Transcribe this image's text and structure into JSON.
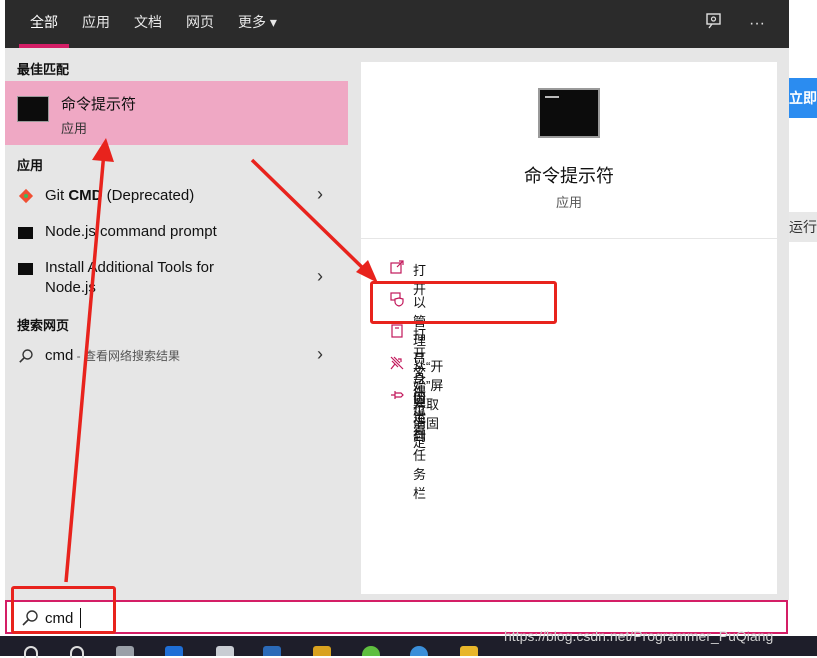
{
  "tabs": [
    {
      "label": "全部",
      "active": true
    },
    {
      "label": "应用"
    },
    {
      "label": "文档"
    },
    {
      "label": "网页"
    },
    {
      "label": "更多"
    }
  ],
  "more_arrow": "▾",
  "top_icons": [
    "feedback-icon",
    "more-options-icon"
  ],
  "more_glyph": "···",
  "best_match": {
    "heading": "最佳匹配",
    "title": "命令提示符",
    "subtitle": "应用"
  },
  "apps": {
    "heading": "应用",
    "items": [
      {
        "label": "Git CMD (Deprecated)",
        "bold": "CMD",
        "prefix": "Git ",
        "suffix": " (Deprecated)"
      },
      {
        "label": "Node.js command prompt"
      },
      {
        "label_line1": "Install Additional Tools for",
        "label_line2": "Node.js"
      }
    ]
  },
  "web": {
    "heading": "搜索网页",
    "query": "cmd",
    "hint": " - 查看网络搜索结果"
  },
  "detail": {
    "title": "命令提示符",
    "subtitle": "应用",
    "actions": [
      {
        "label": "打开",
        "icon": "open-icon"
      },
      {
        "label": "以管理员身份运行",
        "icon": "shield-icon"
      },
      {
        "label": "打开文件位置",
        "icon": "file-location-icon"
      },
      {
        "label": "从“开始”屏幕取消固定",
        "icon": "unpin-icon"
      },
      {
        "label": "固定到任务栏",
        "icon": "pin-icon"
      }
    ]
  },
  "search": {
    "value": "cmd"
  },
  "background": {
    "blue_tab_text": "立即下",
    "gray_tab_text": "运行"
  },
  "watermark": "https://blog.csdn.net/Programmer_PuQiang",
  "colors": {
    "accent": "#d41e66",
    "selection": "#efa8c4",
    "annotation": "#e8231d"
  }
}
